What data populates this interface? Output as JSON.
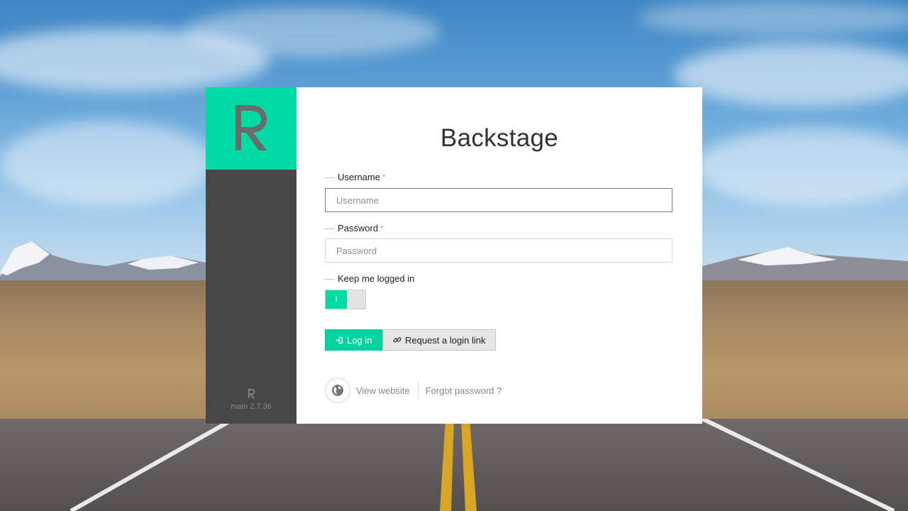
{
  "app": {
    "title": "Backstage",
    "version": "main 2.7.36"
  },
  "form": {
    "username": {
      "label": "Username",
      "required_mark": "*",
      "placeholder": "Username",
      "value": ""
    },
    "password": {
      "label": "Password",
      "required_mark": "*",
      "placeholder": "Password",
      "value": ""
    },
    "keep_logged_in": {
      "label": "Keep me logged in",
      "on_glyph": "I",
      "checked": true
    }
  },
  "buttons": {
    "login_label": "Log in",
    "login_icon": "sign-in-icon",
    "request_link_label": "Request a login link",
    "request_link_icon": "link-icon"
  },
  "footer": {
    "view_website_label": "View website",
    "view_website_icon": "globe-icon",
    "forgot_password_label": "Forgot password ?"
  },
  "colors": {
    "accent": "#00dba6",
    "sidebar": "#474747"
  }
}
